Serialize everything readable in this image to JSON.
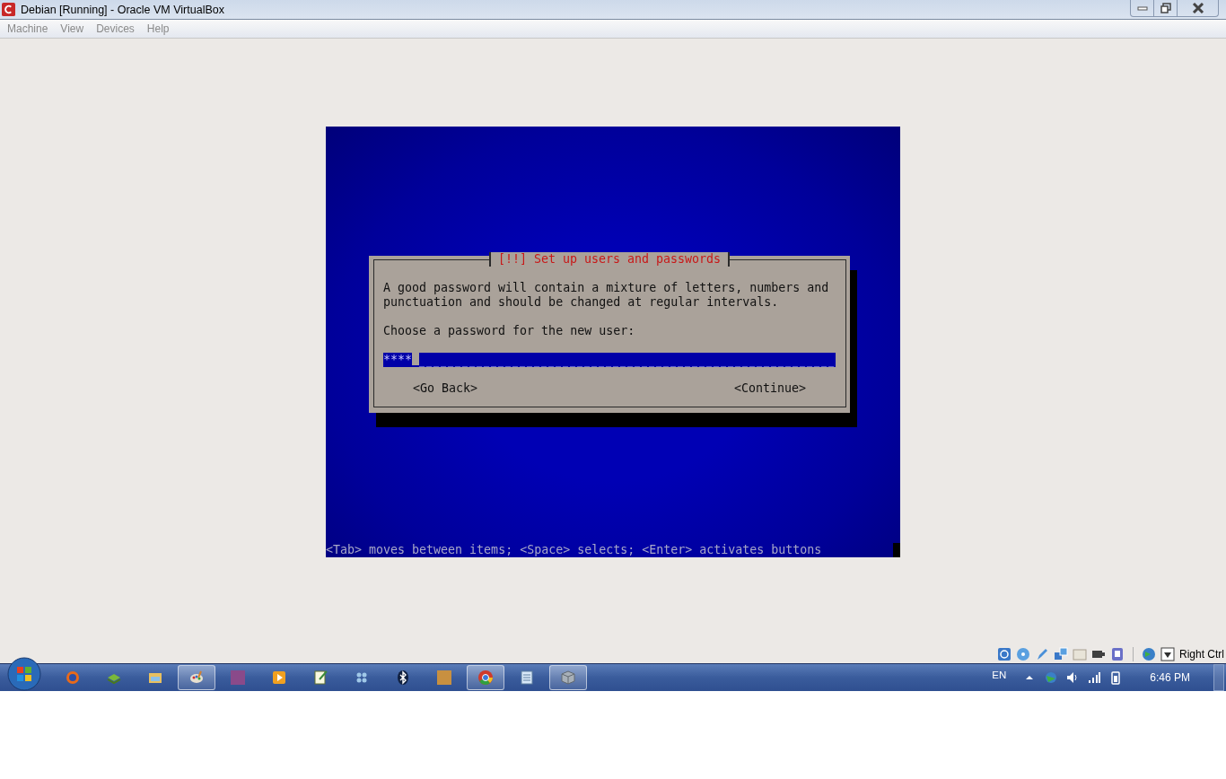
{
  "window": {
    "title": "Debian [Running] - Oracle VM VirtualBox"
  },
  "menu": [
    "Machine",
    "View",
    "Devices",
    "Help"
  ],
  "installer": {
    "dialog_title": "[!!] Set up users and passwords",
    "paragraph": "A good password will contain a mixture of letters, numbers and punctuation and should be changed at regular intervals.",
    "prompt": "Choose a password for the new user:",
    "password": {
      "value": "****"
    },
    "buttons": [
      "<Go Back>",
      "<Continue>"
    ],
    "help_line": "<Tab> moves between items; <Space> selects; <Enter> activates buttons"
  },
  "vm_status_bar": {
    "host_key": "Right Ctrl"
  },
  "taskbar": {
    "items": [
      {
        "active": false
      },
      {
        "active": false
      },
      {
        "active": false
      },
      {
        "active": true
      },
      {
        "active": false
      },
      {
        "active": false
      },
      {
        "active": false
      },
      {
        "active": false
      },
      {
        "active": false
      },
      {
        "active": false
      },
      {
        "active": true
      },
      {
        "active": false
      },
      {
        "active": true
      }
    ],
    "language": "EN",
    "clock": "6:46 PM"
  }
}
